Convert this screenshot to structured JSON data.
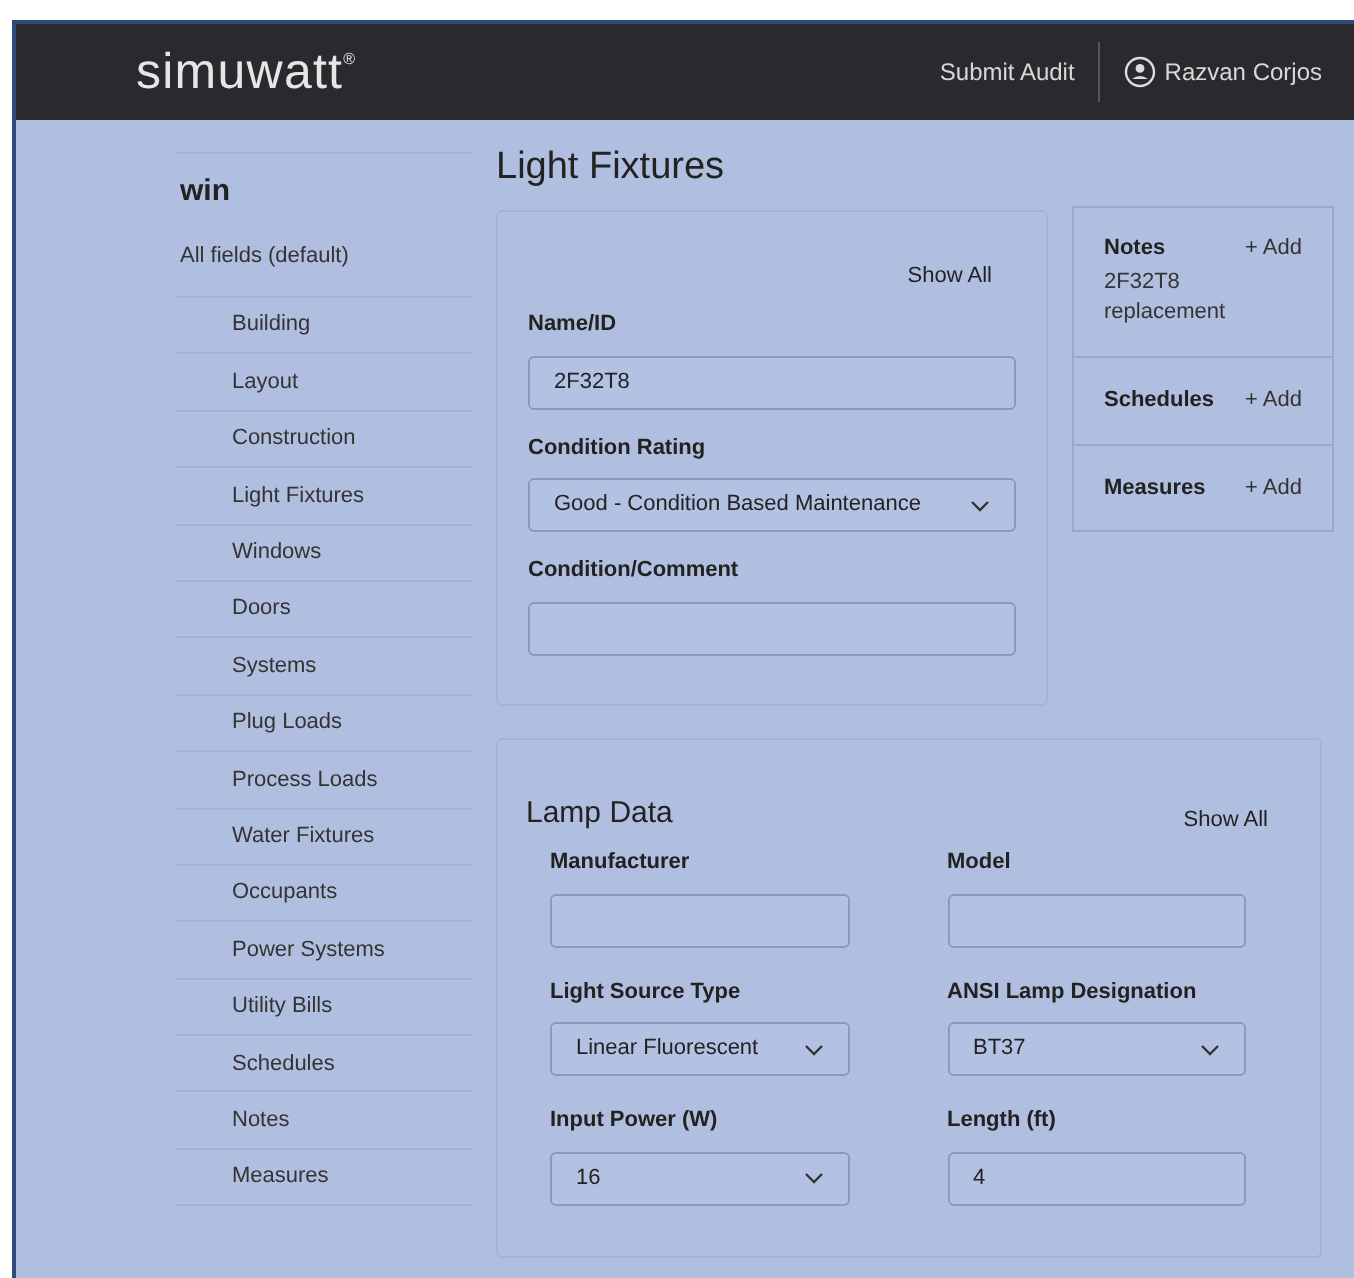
{
  "header": {
    "logo": "simuwatt",
    "trademark": "®",
    "submit": "Submit Audit",
    "user": "Razvan Corjos"
  },
  "sidebar": {
    "title": "win",
    "subtitle": "All fields (default)",
    "items": [
      "Building",
      "Layout",
      "Construction",
      "Light Fixtures",
      "Windows",
      "Doors",
      "Systems",
      "Plug Loads",
      "Process Loads",
      "Water Fixtures",
      "Occupants",
      "Power Systems",
      "Utility Bills",
      "Schedules",
      "Notes",
      "Measures"
    ]
  },
  "page_title": "Light Fixtures",
  "general": {
    "show_all": "Show All",
    "fields": [
      {
        "label": "Name/ID",
        "kind": "input",
        "value": "2F32T8"
      },
      {
        "label": "Condition Rating",
        "kind": "select",
        "value": "Good - Condition Based Maintenance"
      },
      {
        "label": "Condition/Comment",
        "kind": "input"
      }
    ]
  },
  "side_panel": [
    {
      "title": "Notes",
      "action": "+ Add",
      "text": "2F32T8 replacement"
    },
    {
      "title": "Schedules",
      "action": "+ Add"
    },
    {
      "title": "Measures",
      "action": "+ Add"
    }
  ],
  "lamp_data": {
    "title": "Lamp Data",
    "show_all": "Show All",
    "fields": [
      {
        "label": "Manufacturer",
        "kind": "input"
      },
      {
        "label": "Model",
        "kind": "input"
      },
      {
        "label": "Light Source Type",
        "kind": "select",
        "value": "Linear Fluorescent"
      },
      {
        "label": "ANSI Lamp Designation",
        "kind": "select",
        "value": "BT37"
      },
      {
        "label": "Input Power (W)",
        "kind": "select",
        "value": "16"
      },
      {
        "label": "Length (ft)",
        "kind": "input",
        "value": "4"
      }
    ]
  }
}
